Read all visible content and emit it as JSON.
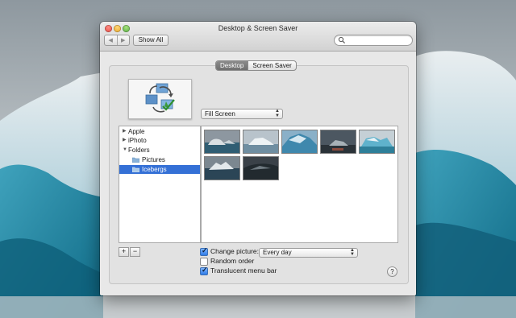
{
  "window": {
    "title": "Desktop & Screen Saver",
    "back_glyph": "◀",
    "forward_glyph": "▶",
    "show_all_label": "Show All",
    "search_placeholder": ""
  },
  "tabs": [
    {
      "label": "Desktop",
      "active": true
    },
    {
      "label": "Screen Saver",
      "active": false
    }
  ],
  "fit_popup": {
    "value": "Fill Screen"
  },
  "sources": [
    {
      "label": "Apple",
      "disclosure": "▶",
      "indent": 0,
      "selected": false,
      "icon": "none"
    },
    {
      "label": "iPhoto",
      "disclosure": "▶",
      "indent": 0,
      "selected": false,
      "icon": "none"
    },
    {
      "label": "Folders",
      "disclosure": "▼",
      "indent": 0,
      "selected": false,
      "icon": "none"
    },
    {
      "label": "Pictures",
      "disclosure": "",
      "indent": 1,
      "selected": false,
      "icon": "folder-icon"
    },
    {
      "label": "Icebergs",
      "disclosure": "",
      "indent": 1,
      "selected": true,
      "icon": "folder-icon"
    }
  ],
  "thumbnails": [
    "iceberg-1",
    "iceberg-2",
    "iceberg-3",
    "iceberg-4",
    "iceberg-5",
    "iceberg-6",
    "iceberg-7"
  ],
  "list_buttons": {
    "add": "+",
    "remove": "−"
  },
  "options": {
    "change_picture": {
      "label": "Change picture:",
      "checked": true
    },
    "interval": {
      "value": "Every day"
    },
    "random_order": {
      "label": "Random order",
      "checked": false
    },
    "translucent_menu_bar": {
      "label": "Translucent menu bar",
      "checked": true
    }
  },
  "help_label": "?",
  "colors": {
    "selection": "#3470d6",
    "tab_active": "#7d7d7d",
    "accent_check": "#2f7ae6"
  }
}
